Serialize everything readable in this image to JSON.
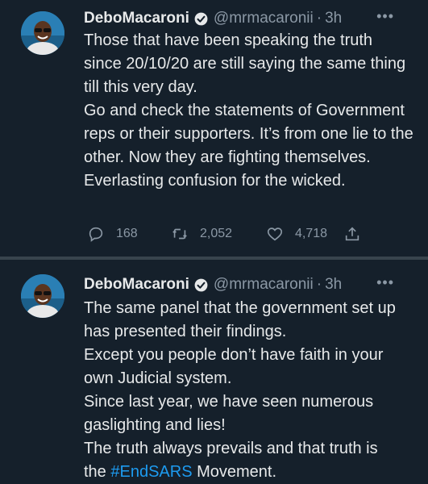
{
  "tweets": [
    {
      "name": "DeboMacaroni",
      "handle": "@mrmacaronii",
      "separator": "·",
      "time": "3h",
      "more": "•••",
      "lines": [
        "Those that have been speaking the truth since 20/10/20 are still saying the same thing till this very day.",
        "Go and check the statements of Government reps or their supporters. It’s from one lie to the other. Now they are fighting themselves.",
        "Everlasting confusion for the wicked."
      ],
      "replies": "168",
      "retweets": "2,052",
      "likes": "4,718"
    },
    {
      "name": "DeboMacaroni",
      "handle": "@mrmacaronii",
      "separator": "·",
      "time": "3h",
      "more": "•••",
      "lines": [
        "The same panel that the government set up has presented their findings.",
        "Except you people don’t have faith in your own Judicial system.",
        "Since last year, we have seen numerous gaslighting and lies!",
        "The truth always prevails and that truth is"
      ],
      "last_line_prefix": "the ",
      "hashtag": "#EndSARS",
      "last_line_suffix": " Movement."
    }
  ],
  "colors": {
    "background": "#15202b",
    "text": "#e7e9ea",
    "secondary": "#8b98a5",
    "accent": "#1d9bf0"
  },
  "icons": [
    "verified-badge-icon",
    "reply-icon",
    "retweet-icon",
    "like-icon",
    "share-icon",
    "more-icon"
  ]
}
